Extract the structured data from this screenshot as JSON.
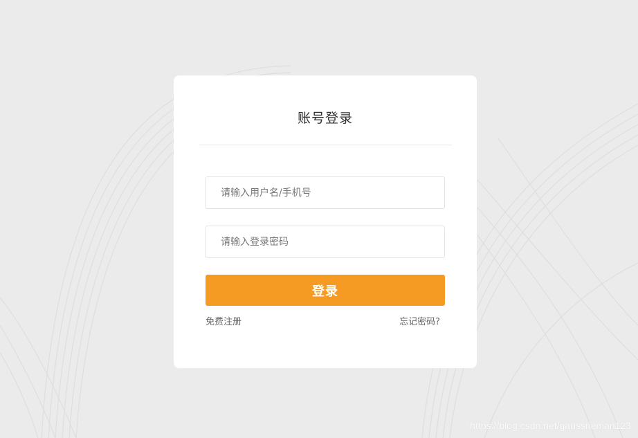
{
  "login": {
    "title": "账号登录",
    "username_placeholder": "请输入用户名/手机号",
    "password_placeholder": "请输入登录密码",
    "submit_label": "登录",
    "register_label": "免费注册",
    "forgot_label": "忘记密码?"
  },
  "watermark": "https://blog.csdn.net/gaussrieman123",
  "colors": {
    "background": "#ebebeb",
    "card": "#ffffff",
    "accent": "#f59a23",
    "link_text": "#666666"
  }
}
